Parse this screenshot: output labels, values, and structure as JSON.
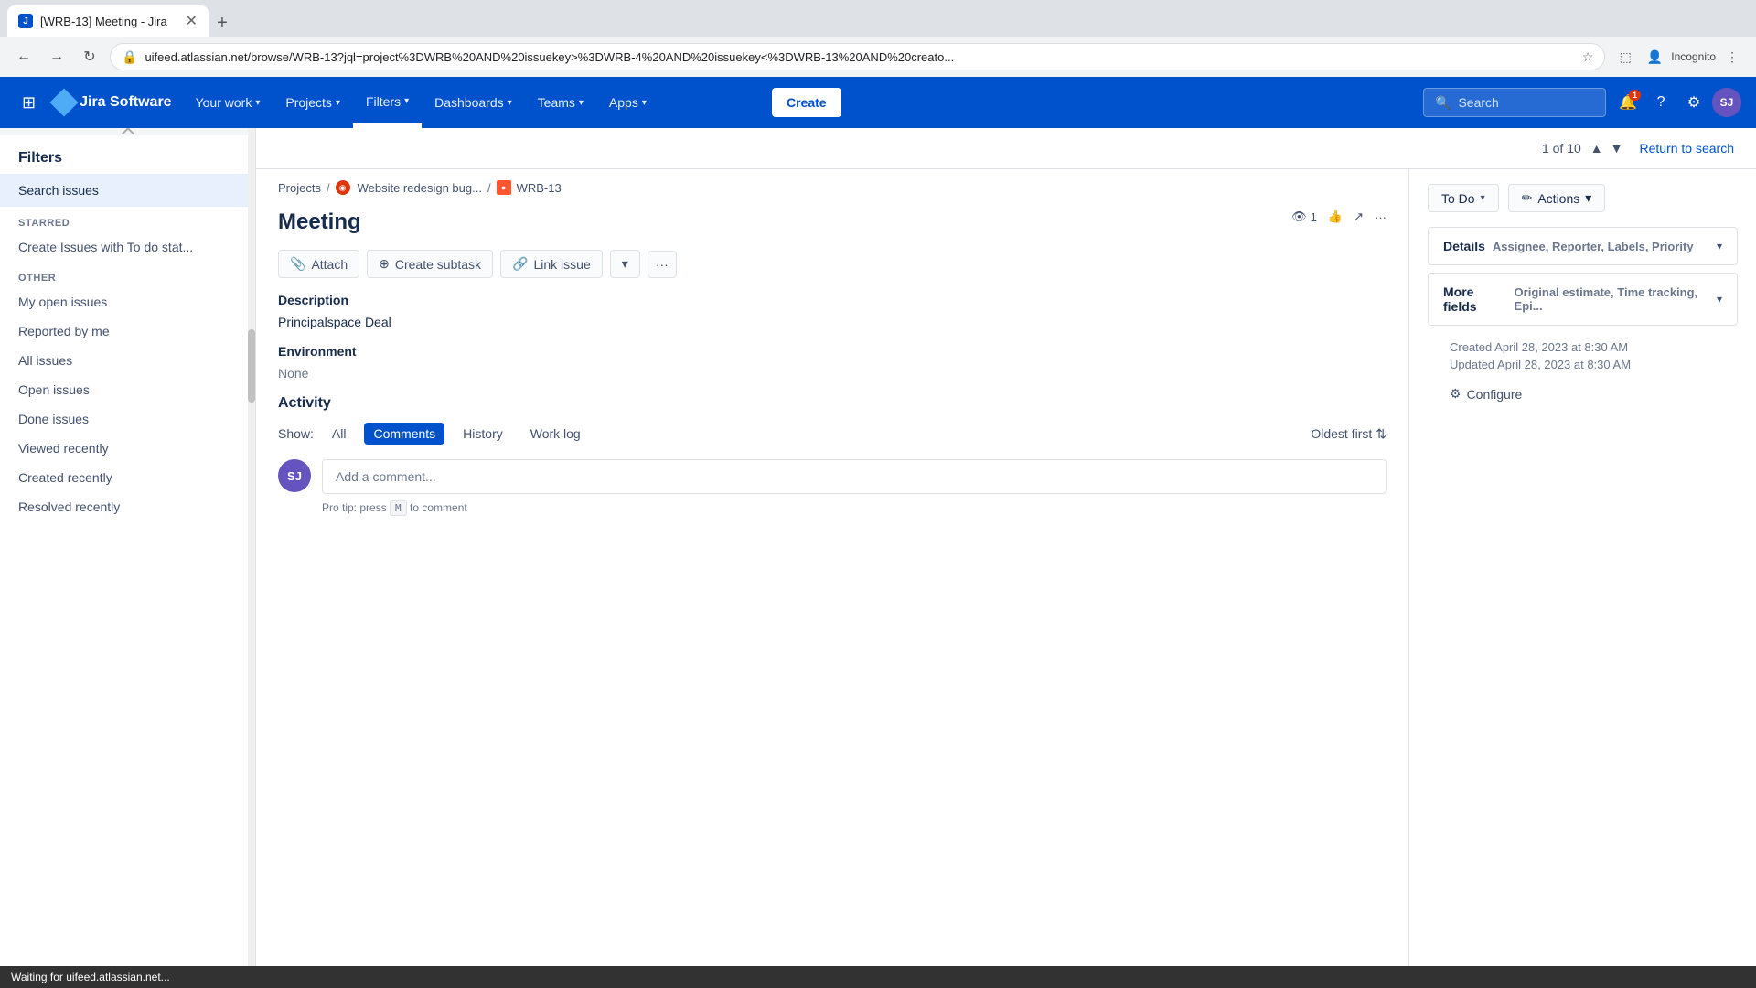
{
  "browser": {
    "tab_title": "[WRB-13] Meeting - Jira",
    "url": "uifeed.atlassian.net/browse/WRB-13?jql=project%3DWRB%20AND%20issuekey>%3DWRB-4%20AND%20issuekey<%3DWRB-13%20AND%20creato...",
    "new_tab_label": "+",
    "incognito_label": "Incognito"
  },
  "topnav": {
    "logo_text": "Jira Software",
    "your_work": "Your work",
    "projects": "Projects",
    "filters": "Filters",
    "dashboards": "Dashboards",
    "teams": "Teams",
    "apps": "Apps",
    "create_label": "Create",
    "search_placeholder": "Search",
    "notif_count": "1",
    "avatar_initials": "SJ"
  },
  "sidebar": {
    "title": "Filters",
    "search_issues": "Search issues",
    "starred_label": "STARRED",
    "starred_item": "Create Issues with To do stat...",
    "other_label": "OTHER",
    "other_items": [
      "My open issues",
      "Reported by me",
      "All issues",
      "Open issues",
      "Done issues",
      "Viewed recently",
      "Created recently",
      "Resolved recently"
    ]
  },
  "main": {
    "pagination": "1 of 10",
    "return_to_search": "Return to search",
    "breadcrumb_projects": "Projects",
    "breadcrumb_project_name": "Website redesign bug...",
    "breadcrumb_issue_id": "WRB-13",
    "issue_title": "Meeting",
    "watchers_count": "1",
    "attach_label": "Attach",
    "create_subtask_label": "Create subtask",
    "link_issue_label": "Link issue",
    "todo_label": "To Do",
    "actions_label": "Actions",
    "description_title": "Description",
    "description_text": "Principalspace Deal",
    "environment_title": "Environment",
    "environment_text": "None",
    "activity_title": "Activity",
    "activity_show_label": "Show:",
    "activity_all": "All",
    "activity_comments": "Comments",
    "activity_history": "History",
    "activity_work_log": "Work log",
    "activity_sort": "Oldest first",
    "comment_placeholder": "Add a comment...",
    "comment_tip": "Pro tip:",
    "comment_tip_press": "press",
    "comment_tip_key": "M",
    "comment_tip_to": "to comment",
    "avatar_initials": "SJ",
    "details_label": "Details",
    "details_sub": "Assignee, Reporter, Labels, Priority",
    "more_fields_label": "More fields",
    "more_fields_sub": "Original estimate, Time tracking, Epi...",
    "created_label": "Created April 28, 2023 at 8:30 AM",
    "updated_label": "Updated April 28, 2023 at 8:30 AM",
    "configure_label": "Configure"
  },
  "status_bar": {
    "text": "Waiting for uifeed.atlassian.net..."
  }
}
